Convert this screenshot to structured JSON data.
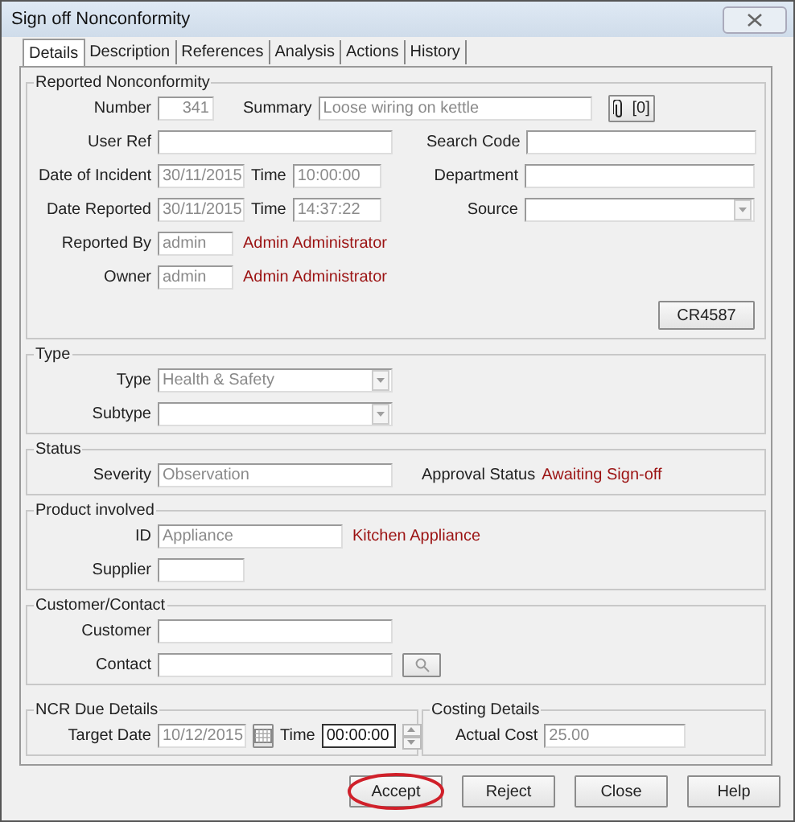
{
  "window": {
    "title": "Sign off Nonconformity"
  },
  "tabs": [
    {
      "label": "Details",
      "selected": true
    },
    {
      "label": "Description",
      "selected": false
    },
    {
      "label": "References",
      "selected": false
    },
    {
      "label": "Analysis",
      "selected": false
    },
    {
      "label": "Actions",
      "selected": false
    },
    {
      "label": "History",
      "selected": false
    }
  ],
  "reported": {
    "title": "Reported Nonconformity",
    "number": {
      "label": "Number",
      "value": "341",
      "disabled": true
    },
    "summary": {
      "label": "Summary",
      "value": "Loose wiring on kettle",
      "disabled": true
    },
    "attachments": {
      "label": "[0]"
    },
    "user_ref": {
      "label": "User Ref"
    },
    "search_code": {
      "label": "Search Code"
    },
    "date_of_incident": {
      "label": "Date of Incident",
      "value": "30/11/2015",
      "disabled": true
    },
    "incident_time": {
      "label": "Time",
      "value": "10:00:00",
      "disabled": true
    },
    "department": {
      "label": "Department"
    },
    "date_reported": {
      "label": "Date Reported",
      "value": "30/11/2015",
      "disabled": true
    },
    "reported_time": {
      "label": "Time",
      "value": "14:37:22",
      "disabled": true
    },
    "source": {
      "label": "Source",
      "disabled": true
    },
    "reported_by": {
      "label": "Reported By",
      "value": "admin",
      "name": "Admin Administrator",
      "disabled": true
    },
    "owner": {
      "label": "Owner",
      "value": "admin",
      "name": "Admin Administrator",
      "disabled": true
    },
    "reference_button": "CR4587"
  },
  "type": {
    "title": "Type",
    "type": {
      "label": "Type",
      "value": "Health & Safety",
      "disabled": true
    },
    "subtype": {
      "label": "Subtype",
      "disabled": true
    }
  },
  "status": {
    "title": "Status",
    "severity": {
      "label": "Severity",
      "value": "Observation",
      "disabled": true
    },
    "approval_label": "Approval Status",
    "approval_value": "Awaiting Sign-off"
  },
  "product": {
    "title": "Product involved",
    "id": {
      "label": "ID",
      "value": "Appliance",
      "name": "Kitchen Appliance",
      "disabled": true
    },
    "supplier": {
      "label": "Supplier"
    }
  },
  "customer": {
    "title": "Customer/Contact",
    "customer": {
      "label": "Customer"
    },
    "contact": {
      "label": "Contact"
    }
  },
  "due": {
    "title": "NCR Due Details",
    "target_date": {
      "label": "Target Date",
      "value": "10/12/2015",
      "disabled": true
    },
    "time": {
      "label": "Time",
      "value": "00:00:00",
      "disabled": false
    }
  },
  "costing": {
    "title": "Costing Details",
    "actual_cost": {
      "label": "Actual Cost",
      "value": "25.00",
      "disabled": true
    }
  },
  "buttons": [
    {
      "label": "Accept",
      "highlighted": true
    },
    {
      "label": "Reject",
      "highlighted": false
    },
    {
      "label": "Close",
      "highlighted": false
    },
    {
      "label": "Help",
      "highlighted": false
    }
  ]
}
